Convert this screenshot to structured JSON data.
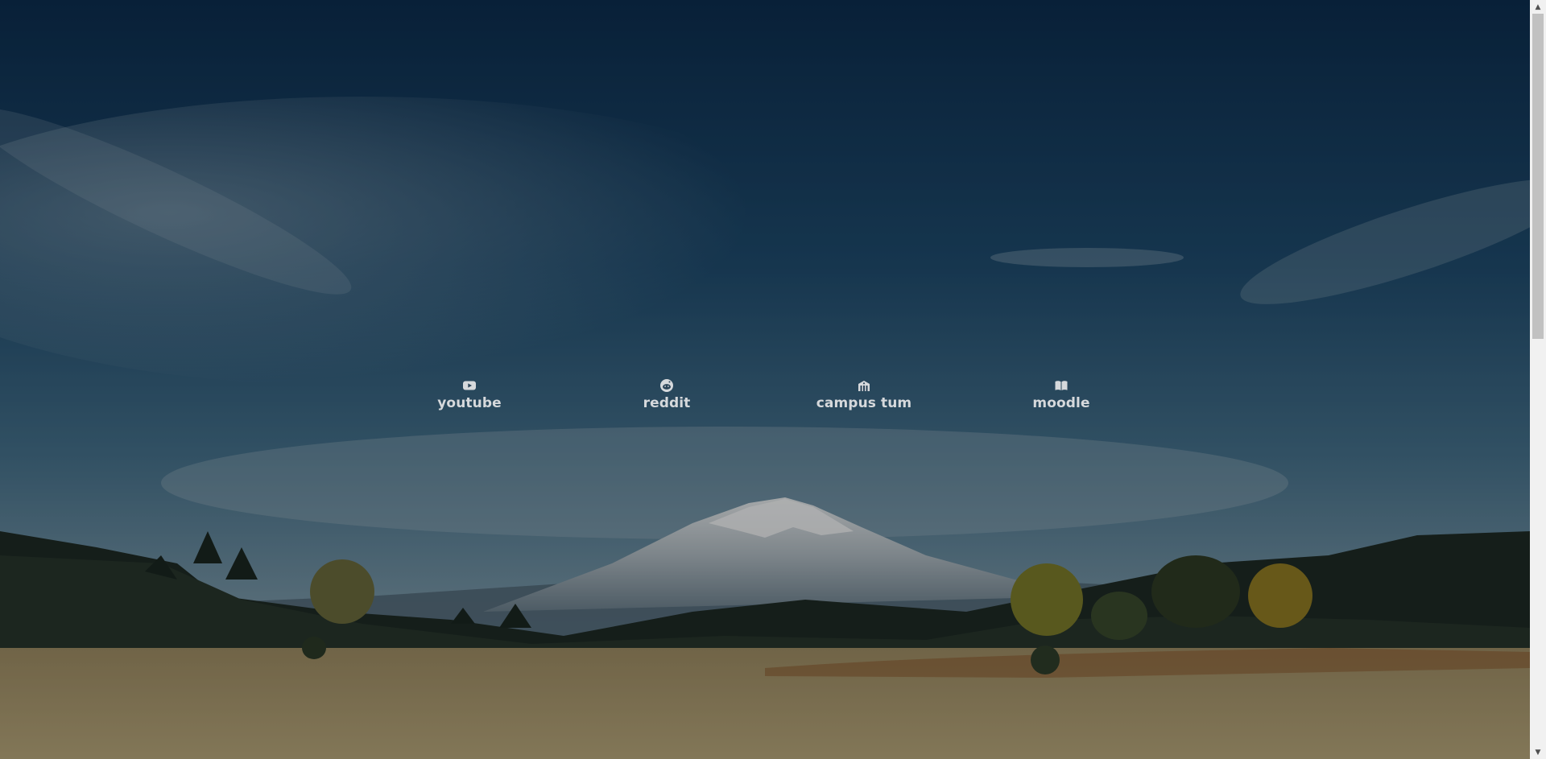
{
  "links": [
    {
      "label": "youtube",
      "icon": "youtube-icon"
    },
    {
      "label": "reddit",
      "icon": "reddit-icon"
    },
    {
      "label": "campus tum",
      "icon": "university-icon"
    },
    {
      "label": "moodle",
      "icon": "book-open-icon"
    }
  ],
  "colors": {
    "sky_top": "#0b2a4a",
    "sky_mid": "#2e5a78",
    "sky_horizon": "#6f8ea0",
    "field": "#8a7a55",
    "link_text": "#d6d9dc",
    "scrollbar_track": "#f1f1f1",
    "scrollbar_thumb": "#c1c1c1"
  },
  "scrollbar": {
    "up_arrow": "▲",
    "down_arrow": "▼"
  }
}
